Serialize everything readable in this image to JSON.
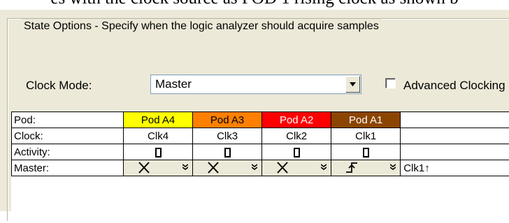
{
  "caption": "es with the clock source as POD 1 rising clock as shown b",
  "group": {
    "legend": "State Options - Specify when the logic analyzer should acquire samples"
  },
  "clock_mode": {
    "label": "Clock Mode:",
    "value": "Master"
  },
  "advanced": {
    "label": "Advanced Clocking",
    "checked": false
  },
  "table": {
    "row_labels": {
      "pod": "Pod:",
      "clock": "Clock:",
      "activity": "Activity:",
      "master": "Master:"
    },
    "pods": [
      {
        "name": "Pod A4",
        "clock": "Clk4",
        "color": "#ffff00",
        "text_color": "#000000",
        "master": "x-icon"
      },
      {
        "name": "Pod A3",
        "clock": "Clk3",
        "color": "#ff8000",
        "text_color": "#000000",
        "master": "x-icon"
      },
      {
        "name": "Pod A2",
        "clock": "Clk2",
        "color": "#ff0000",
        "text_color": "#ffffff",
        "master": "x-icon"
      },
      {
        "name": "Pod A1",
        "clock": "Clk1",
        "color": "#8b4500",
        "text_color": "#ffffff",
        "master": "rising-edge-icon"
      }
    ],
    "master_summary": "Clk1↑"
  }
}
